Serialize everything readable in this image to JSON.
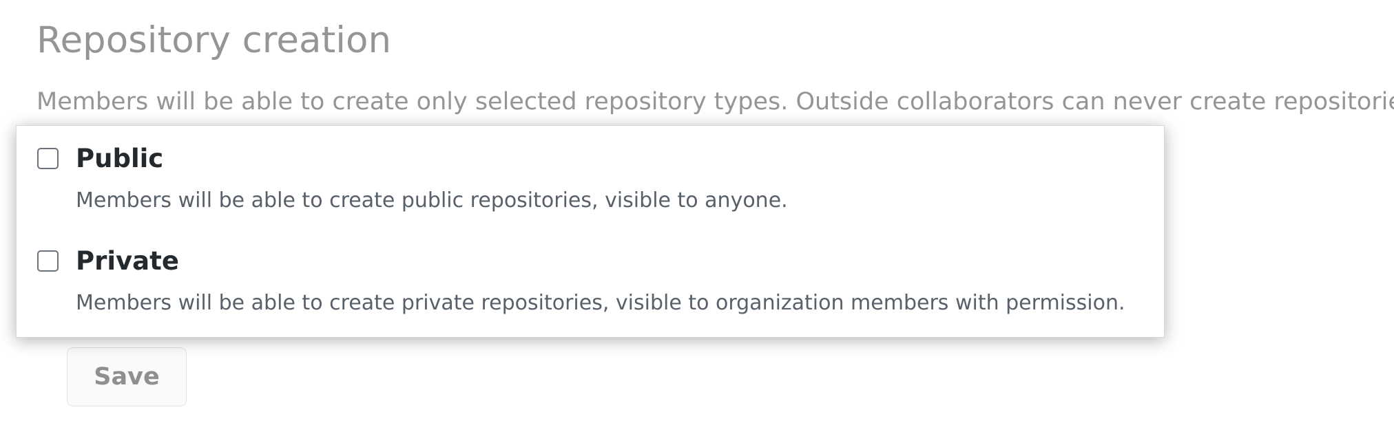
{
  "section": {
    "title": "Repository creation",
    "description": "Members will be able to create only selected repository types. Outside collaborators can never create repositories."
  },
  "options": [
    {
      "label": "Public",
      "note": "Members will be able to create public repositories, visible to anyone.",
      "checked": false
    },
    {
      "label": "Private",
      "note": "Members will be able to create private repositories, visible to organization members with permission.",
      "checked": false
    }
  ],
  "actions": {
    "save_label": "Save"
  },
  "colors": {
    "muted_text": "#959595",
    "heading_text": "#24292e",
    "note_text": "#586069",
    "checkbox_border": "#6a737d"
  }
}
